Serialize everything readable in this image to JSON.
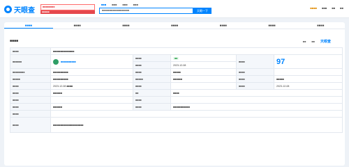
{
  "brand": {
    "name": "天眼查"
  },
  "promo": {
    "line1": "■■■■■■■■",
    "line2": "■■■■■■"
  },
  "top_tabs": [
    "■■■",
    "■■■",
    "■■■",
    "■■■"
  ],
  "search": {
    "value": "■■■■■■■■■■■■■■■■■■",
    "button": "天眼一下"
  },
  "topnav": [
    "■■■■",
    "■■■",
    "■■",
    "■■"
  ],
  "subtabs": [
    "■■■■",
    "■■■■",
    "■■■■",
    "■■■■",
    "■■■■",
    "■■■■",
    "■■■■"
  ],
  "section": {
    "title": "■■■■",
    "actions": [
      "■■",
      "■■"
    ],
    "brand_tag": "天眼查"
  },
  "rows": [
    {
      "l1": "■■■■",
      "v1": "■■■■■■■■■■■■■■",
      "l2": "",
      "v2": "",
      "l3": "",
      "v3": ""
    },
    {
      "l1": "■■■■■■",
      "v1": "■■■■■■■■■■",
      "l2": "■■■■",
      "v2": "■■",
      "l3": "■■■■",
      "v3": "97"
    },
    {
      "l1": "",
      "v1": "",
      "l2": "■■■■",
      "v2": "2023-12-08",
      "l3": "",
      "v3": ""
    },
    {
      "l1": "■■■■■■■■",
      "v1": "■■■■■■■■■■",
      "l2": "■■■■",
      "v2": "■■■■■",
      "l3": "■■■■",
      "v3": ""
    },
    {
      "l1": "■■■■■",
      "v1": "■■■■■■■■■■",
      "l2": "■■■■■",
      "v2": "■■■■■■",
      "l3": "■■■■",
      "v3": "■■■■■"
    },
    {
      "l1": "■■■■",
      "v1": "2023-12-08 ■■■■",
      "l2": "■■■■",
      "v2": "",
      "l3": "■■■■",
      "v3": "2023-12-08"
    },
    {
      "l1": "■■■■",
      "v1": "■■■■■■",
      "l2": "■■",
      "v2": "■■■■",
      "l3": "",
      "v3": ""
    },
    {
      "l1": "■■■■",
      "v1": "",
      "l2": "■■■■",
      "v2": "",
      "l3": "",
      "v3": ""
    },
    {
      "l1": "■■■■",
      "v1": "■■■■■■",
      "l2": "■■■■",
      "v2": "■■■■■■■■■■■",
      "l3": "",
      "v3": ""
    },
    {
      "l1": "■■■■",
      "v1": "",
      "l2": "",
      "v2": "",
      "l3": "",
      "v3": ""
    },
    {
      "l1": "■■■■",
      "v1": "■■■■■■■■■■■■■■■■■■■■",
      "l2": "",
      "v2": "",
      "l3": "",
      "v3": ""
    }
  ]
}
